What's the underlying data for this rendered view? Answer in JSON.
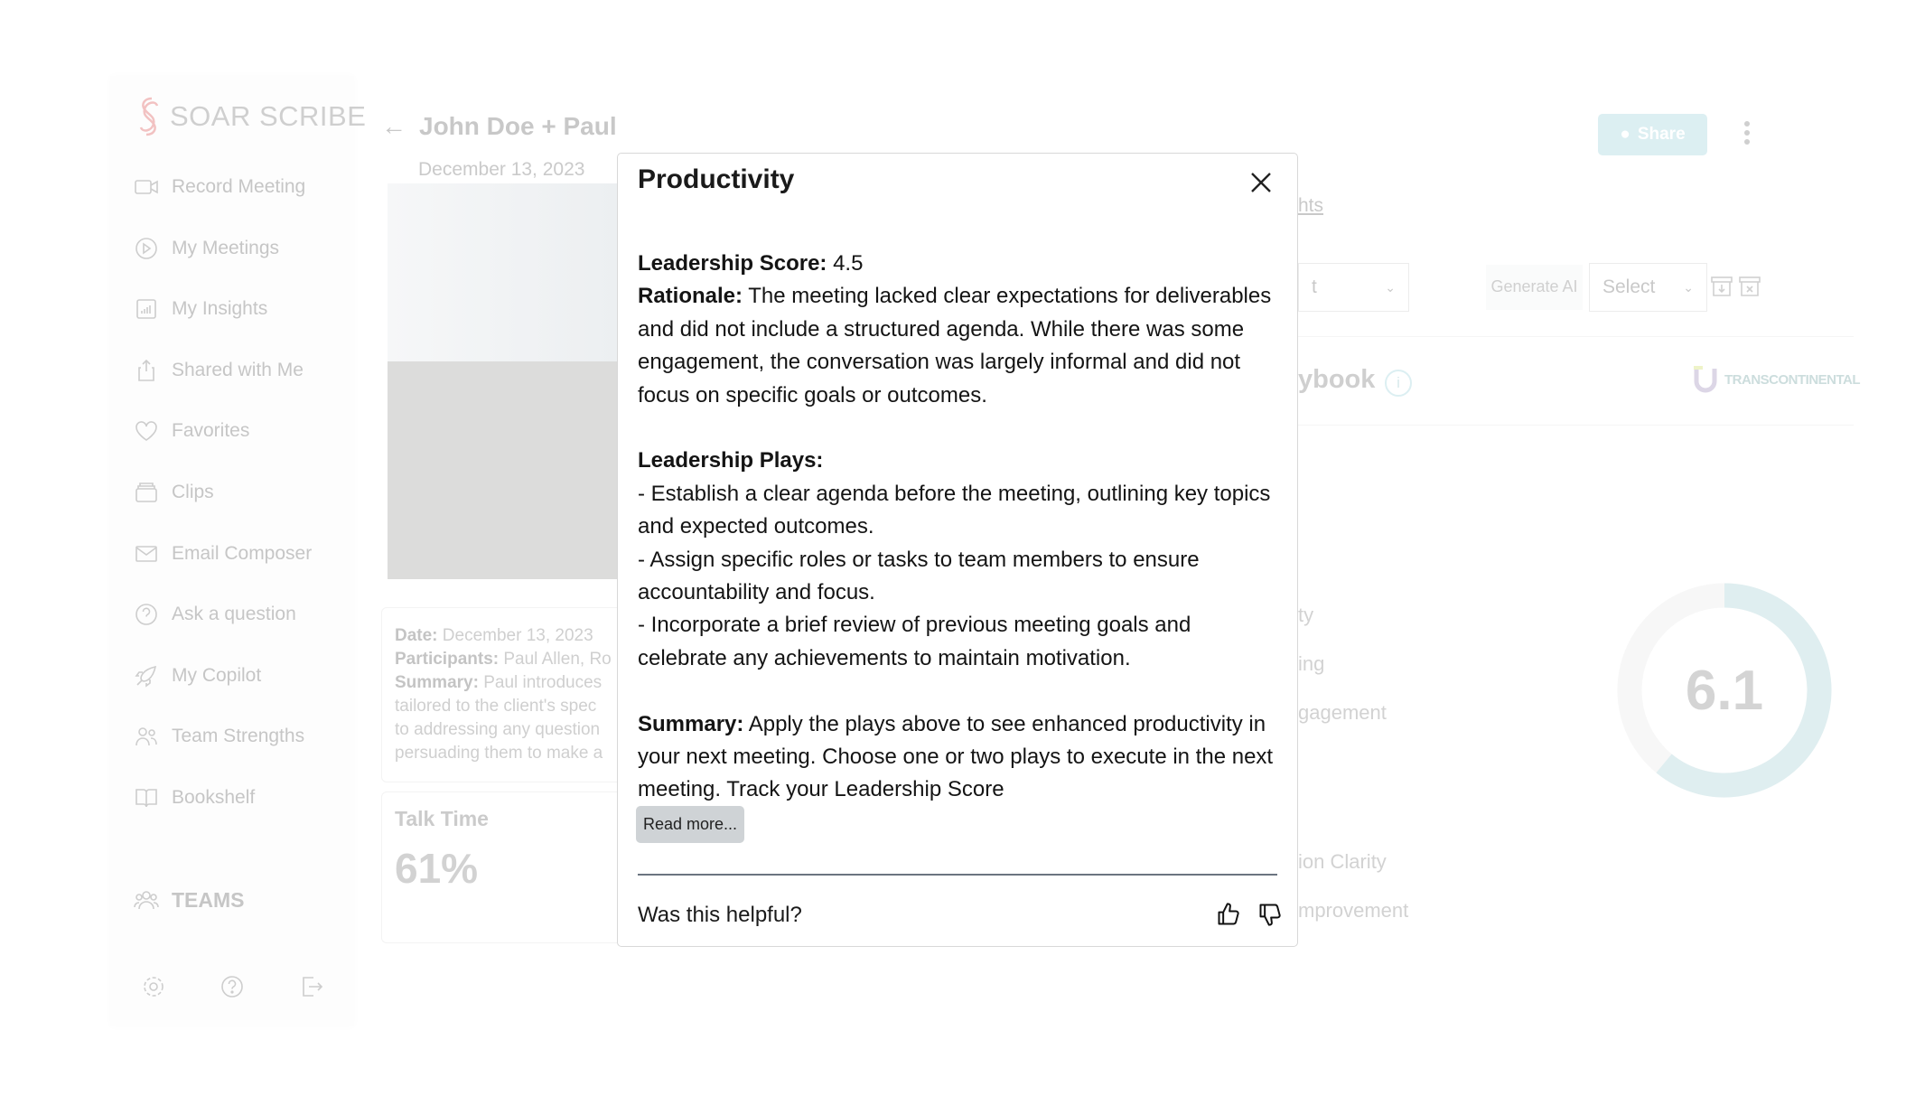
{
  "app": {
    "logo": "SOAR SCRIBE",
    "brand_color": "#f0b8b8"
  },
  "sidebar": {
    "items": [
      {
        "label": "Record Meeting",
        "icon": "video-camera-icon"
      },
      {
        "label": "My Meetings",
        "icon": "play-circle-icon"
      },
      {
        "label": "My Insights",
        "icon": "bar-chart-icon"
      },
      {
        "label": "Shared with Me",
        "icon": "share-icon"
      },
      {
        "label": "Favorites",
        "icon": "heart-icon"
      },
      {
        "label": "Clips",
        "icon": "clips-icon"
      },
      {
        "label": "Email Composer",
        "icon": "mail-icon"
      },
      {
        "label": "Ask a question",
        "icon": "question-circle-icon"
      },
      {
        "label": "My Copilot",
        "icon": "rocket-icon"
      },
      {
        "label": "Team Strengths",
        "icon": "users-icon"
      },
      {
        "label": "Bookshelf",
        "icon": "book-icon"
      }
    ],
    "teams": "TEAMS",
    "bottom_icons": [
      "gear-icon",
      "help-icon",
      "logout-icon"
    ]
  },
  "meeting": {
    "title": "John Doe + Paul",
    "date": "December 13, 2023",
    "summary": {
      "date_label": "Date:",
      "date": "December 13, 2023",
      "participants_label": "Participants:",
      "participants": "Paul Allen, Ro",
      "summary_label": "Summary:",
      "lines": [
        "Paul introduces",
        "tailored to the client's spec",
        "to addressing any question",
        "persuading them to make a"
      ]
    },
    "talk_time": {
      "label": "Talk Time",
      "value": "61%"
    }
  },
  "header": {
    "share": "Share",
    "tab_partial": "hts"
  },
  "toolbar": {
    "dropdown_partial": "t",
    "generate": "Generate AI",
    "select": "Select"
  },
  "playbook": {
    "title_partial": "ybook",
    "logo": "TRANSCONTINENTAL UNIVERSITY"
  },
  "metrics": [
    "ty",
    "ing",
    "gagement",
    "ion Clarity",
    "mprovement"
  ],
  "score": {
    "value": "6.1",
    "fraction": 0.61,
    "fill_color": "#dfeef0",
    "track_color": "#f7f7f7"
  },
  "modal": {
    "title": "Productivity",
    "score_label": "Leadership Score:",
    "score": "4.5",
    "rationale_label": "Rationale:",
    "rationale": "The meeting lacked clear expectations for deliverables and did not include a structured agenda. While there was some engagement, the conversation was largely informal and did not focus on specific goals or outcomes.",
    "plays_label": "Leadership Plays:",
    "plays": [
      "- Establish a clear agenda before the meeting, outlining key topics and expected outcomes.",
      "- Assign specific roles or tasks to team members to ensure accountability and focus.",
      "- Incorporate a brief review of previous meeting goals and celebrate any achievements to maintain motivation."
    ],
    "summary_label": "Summary:",
    "summary": "Apply the plays above to see enhanced productivity in your next meeting. Choose one or two plays to execute in the next meeting. Track your Leadership Score",
    "read_more": "Read more...",
    "helpful": "Was this helpful?"
  }
}
